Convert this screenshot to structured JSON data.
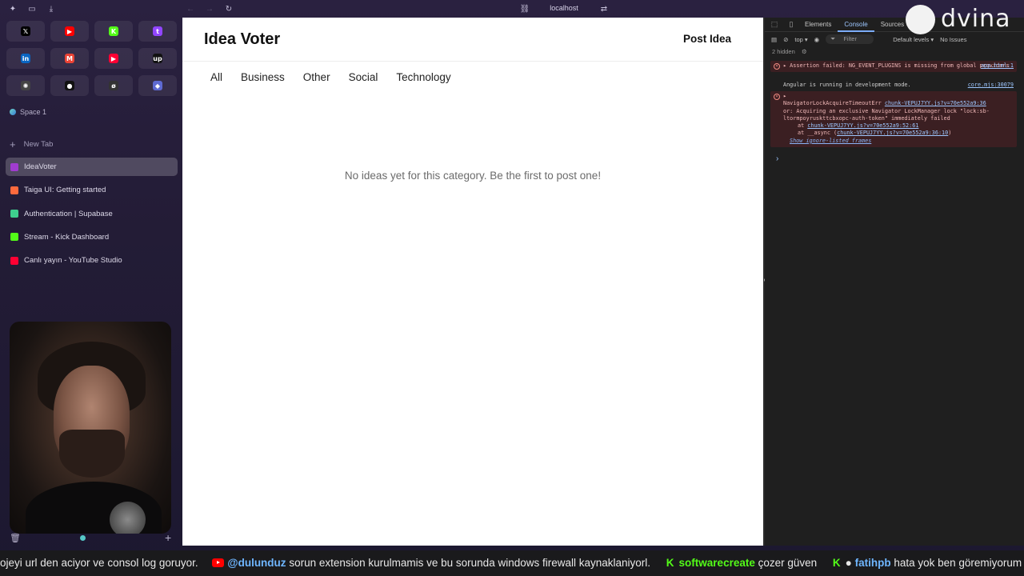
{
  "browser": {
    "url": "localhost"
  },
  "sidebar": {
    "pinned": [
      {
        "icon": "x-icon",
        "glyph": "𝕏",
        "color": "#000000"
      },
      {
        "icon": "youtube-icon",
        "glyph": "▶",
        "color": "#ff0000"
      },
      {
        "icon": "kick-icon",
        "glyph": "K",
        "color": "#53fc18"
      },
      {
        "icon": "twitch-icon",
        "glyph": "t",
        "color": "#9146ff"
      },
      {
        "icon": "linkedin-icon",
        "glyph": "in",
        "color": "#0a66c2"
      },
      {
        "icon": "gmail-icon",
        "glyph": "M",
        "color": "#ea4335"
      },
      {
        "icon": "youtube-studio-icon",
        "glyph": "▶",
        "color": "#ff0033"
      },
      {
        "icon": "upwork-icon",
        "glyph": "up",
        "color": "#111111"
      },
      {
        "icon": "openai-icon",
        "glyph": "✺",
        "color": "#444444"
      },
      {
        "icon": "circle-app-icon",
        "glyph": "●",
        "color": "#111111"
      },
      {
        "icon": "slash-app-icon",
        "glyph": "ø",
        "color": "#333333"
      },
      {
        "icon": "linear-icon",
        "glyph": "◆",
        "color": "#5e6ad2"
      }
    ],
    "space_label": "Space 1",
    "new_tab_label": "New Tab",
    "tabs": [
      {
        "label": "IdeaVoter",
        "icon": "idea-voter-icon",
        "color": "#a03ccf",
        "active": true
      },
      {
        "label": "Taiga UI: Getting started",
        "icon": "taiga-icon",
        "color": "#ff6a3d",
        "active": false
      },
      {
        "label": "Authentication | Supabase",
        "icon": "supabase-icon",
        "color": "#3ecf8e",
        "active": false
      },
      {
        "label": "Stream - Kick Dashboard",
        "icon": "kick-icon",
        "color": "#53fc18",
        "active": false
      },
      {
        "label": "Canlı yayın - YouTube Studio",
        "icon": "youtube-studio-icon",
        "color": "#ff0033",
        "active": false
      }
    ]
  },
  "app": {
    "brand": "Idea Voter",
    "post_button": "Post Idea",
    "categories": [
      "All",
      "Business",
      "Other",
      "Social",
      "Technology"
    ],
    "empty_message": "No ideas yet for this category. Be the first to post one!"
  },
  "devtools": {
    "tabs": [
      "Elements",
      "Console",
      "Sources"
    ],
    "active_tab": "Console",
    "context": "top ▾",
    "filter_placeholder": "Filter",
    "levels": "Default levels ▾",
    "issues": "No Issues",
    "hidden_count": "2 hidden",
    "messages": {
      "m1_text": "▸ Assertion failed: NG_EVENT_PLUGINS is missing from global providers",
      "m1_link": "app.html:1",
      "m2_text": "Angular is running in development mode.",
      "m2_link": "core.mjs:30079",
      "m3_head": "▸",
      "m3_line1": "NavigatorLockAcquireTimeoutErr",
      "m3_link1": "chunk-VEPUJ7YY.js?v=70e552a9:36",
      "m3_line2": "or: Acquiring an exclusive Navigator LockManager lock \"lock:sb-ltormpoyruskttcbxopc-auth-token\" immediately failed",
      "m3_at1_prefix": "at ",
      "m3_at1_link": "chunk-VEPUJ7YY.js?v=70e552a9:52:61",
      "m3_at2_prefix": "at __async (",
      "m3_at2_link": "chunk-VEPUJ7YY.js?v=70e552a9:36:10",
      "m3_at2_suffix": ")",
      "m3_ignore": "Show ignore-listed frames"
    },
    "prompt": "›"
  },
  "watermark": {
    "text": "dvina"
  },
  "ticker": {
    "seg1_text": "ojeyi url den aciyor ve consol log goruyor.",
    "seg2_user": "@dulunduz",
    "seg2_text": " sorun extension kurulmamis ve bu sorunda windows firewall kaynaklaniyorl.",
    "seg3_user": "softwarecreate",
    "seg3_text": " çozer güven",
    "seg4_user": "fatihpb",
    "seg4_text": " hata yok ben göremiyorum"
  }
}
